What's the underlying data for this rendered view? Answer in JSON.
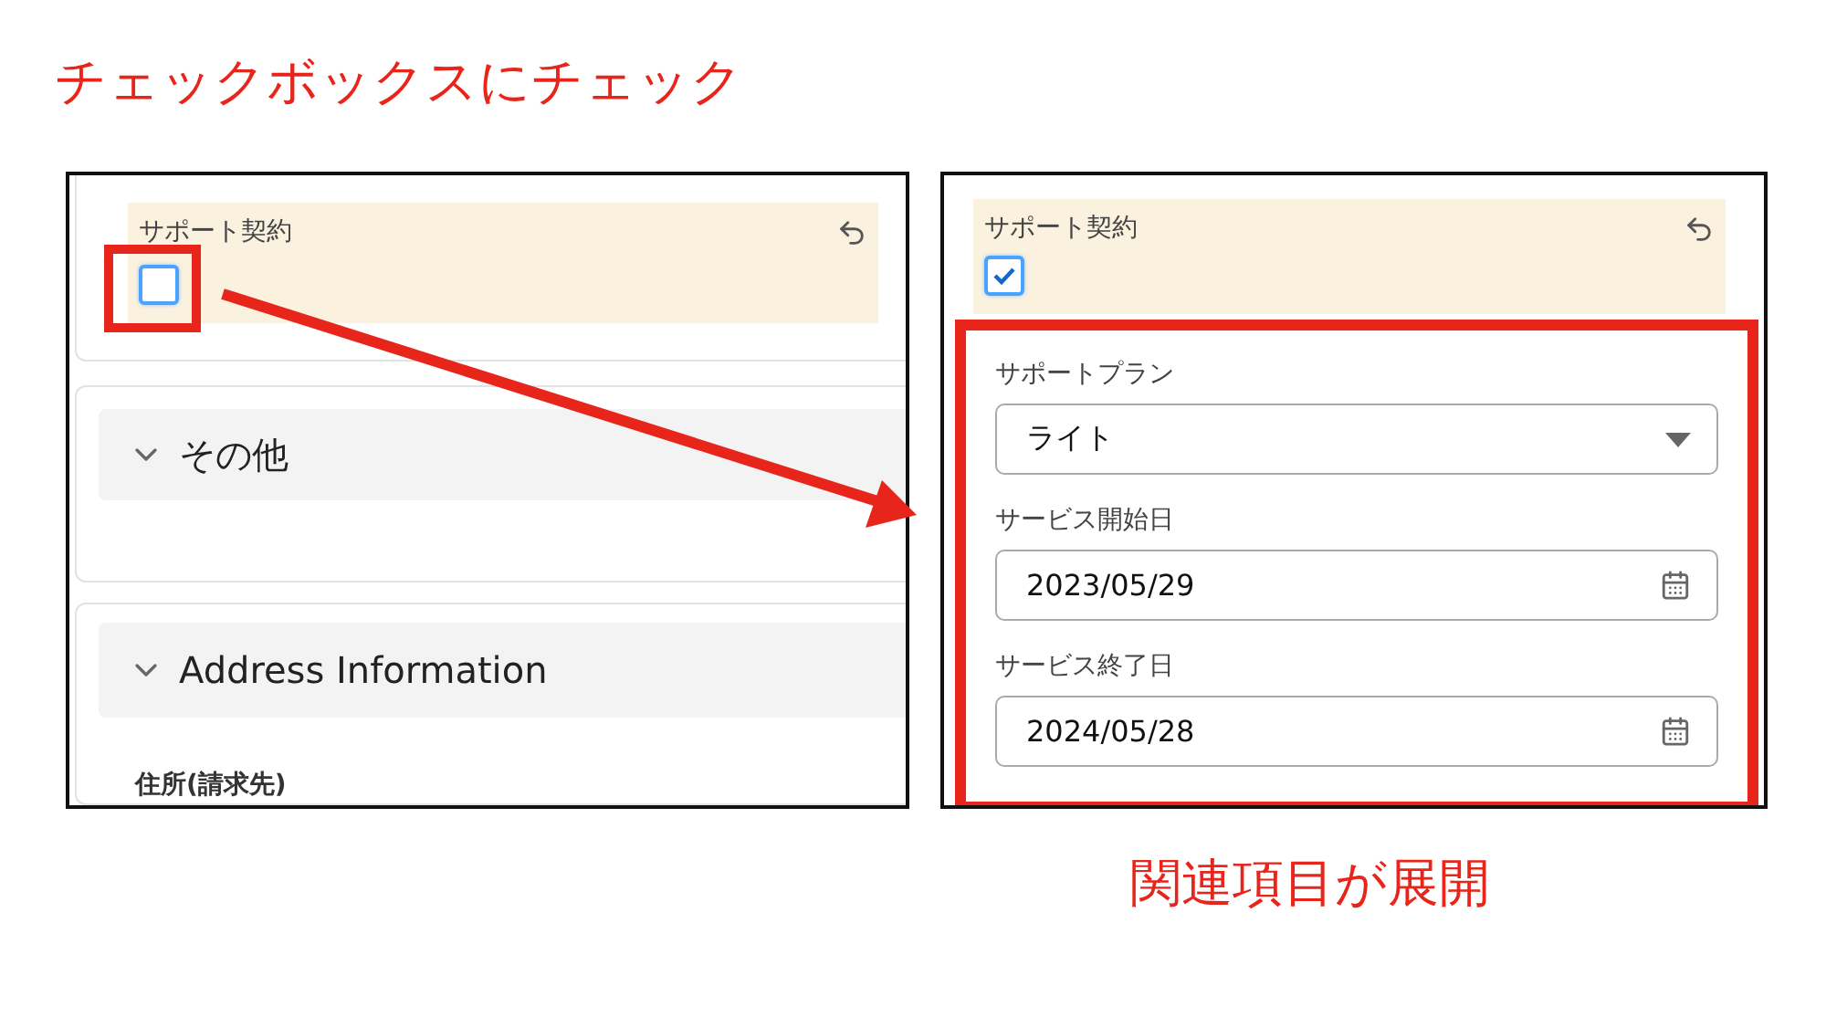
{
  "heading": "チェックボックスにチェック",
  "before": {
    "contract_field": {
      "label": "サポート契約",
      "checked": false
    },
    "sections": [
      {
        "title": "その他",
        "expanded": true
      },
      {
        "title": "Address Information",
        "expanded": true,
        "field_label": "住所(請求先)"
      }
    ]
  },
  "after": {
    "contract_field": {
      "label": "サポート契約",
      "checked": true
    },
    "fields": [
      {
        "kind": "select",
        "label": "サポートプラン",
        "value": "ライト"
      },
      {
        "kind": "date",
        "label": "サービス開始日",
        "value": "2023/05/29"
      },
      {
        "kind": "date",
        "label": "サービス終了日",
        "value": "2024/05/28"
      }
    ]
  },
  "caption": "関連項目が展開"
}
